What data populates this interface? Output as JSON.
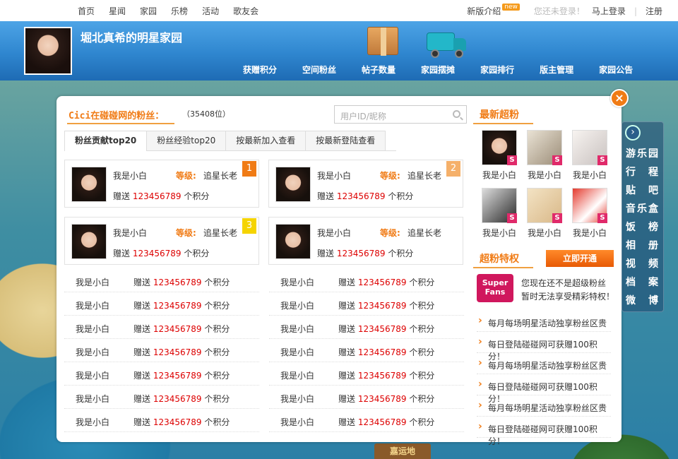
{
  "topbar": {
    "nav": [
      "首页",
      "星闻",
      "家园",
      "乐榜",
      "活动",
      "歌友会"
    ],
    "new_intro": "新版介绍",
    "new_badge": "new",
    "not_logged": "您还未登录！",
    "login": "马上登录",
    "register": "注册"
  },
  "header": {
    "title": "堀北真希的明星家园",
    "nav": [
      "获赠积分",
      "空间粉丝",
      "帖子数量",
      "家园摆摊",
      "家园排行",
      "版主管理",
      "家园公告"
    ]
  },
  "panel": {
    "title": "Cici在碰碰网的粉丝：",
    "rank": "（35408位）",
    "search_placeholder": "用户ID/昵称",
    "tabs": [
      "粉丝贡献top20",
      "粉丝经验top20",
      "按最新加入查看",
      "按最新登陆查看"
    ],
    "close": "×",
    "top_cards": [
      {
        "rank": "1",
        "name": "我是小白",
        "level_label": "等级:",
        "level": "追星长老",
        "gift": "赠送",
        "points": "123456789",
        "unit": "个积分",
        "color": "#f07b15"
      },
      {
        "rank": "2",
        "name": "我是小白",
        "level_label": "等级:",
        "level": "追星长老",
        "gift": "赠送",
        "points": "123456789",
        "unit": "个积分",
        "color": "#f5b06a"
      },
      {
        "rank": "3",
        "name": "我是小白",
        "level_label": "等级:",
        "level": "追星长老",
        "gift": "赠送",
        "points": "123456789",
        "unit": "个积分",
        "color": "#f5d400"
      },
      {
        "rank": "",
        "name": "我是小白",
        "level_label": "等级:",
        "level": "追星长老",
        "gift": "赠送",
        "points": "123456789",
        "unit": "个积分",
        "color": ""
      }
    ],
    "row": {
      "name": "我是小白",
      "gift": "赠送",
      "points": "123456789",
      "unit": "个积分"
    }
  },
  "right": {
    "latest_title": "最新超粉",
    "fans": [
      "我是小白",
      "我是小白",
      "我是小白",
      "我是小白",
      "我是小白",
      "我是小白"
    ],
    "s_badge": "S",
    "privilege_title": "超粉特权",
    "open_button": "立即开通",
    "superfans_logo": "Super Fans",
    "superfans_text1": "您现在还不是超级粉丝",
    "superfans_text2": "暂时无法享受精彩特权！",
    "privileges": [
      "每月每场明星活动独享粉丝区贵",
      "每日登陆碰碰网可获赠100积分！",
      "每月每场明星活动独享粉丝区贵",
      "每日登陆碰碰网可获赠100积分！",
      "每月每场明星活动独享粉丝区贵",
      "每日登陆碰碰网可获赠100积分！"
    ]
  },
  "sidenav": [
    "游乐园",
    "行　程",
    "贴　吧",
    "音乐盒",
    "饭　榜",
    "相　册",
    "视　频",
    "档　案",
    "微　博"
  ],
  "bg_sign": "嘉运地"
}
